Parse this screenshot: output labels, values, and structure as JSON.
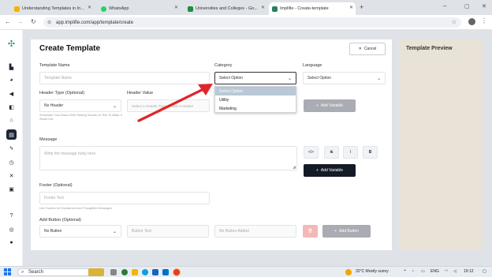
{
  "browser": {
    "tabs": [
      {
        "label": "Understanding Templates in In...",
        "favicon_color": "#f5b100"
      },
      {
        "label": "WhatsApp",
        "favicon_color": "#25d366"
      },
      {
        "label": "Universities and Colleges - Go...",
        "favicon_color": "#1e8e3e"
      },
      {
        "label": "Implifie - Create-template",
        "favicon_color": "#2a7f62"
      }
    ],
    "new_tab": "+",
    "url": "app.implifie.com/app/template/create",
    "window_controls": {
      "minimize": "–",
      "maximize": "▢",
      "close": "✕"
    }
  },
  "sidebar": {
    "icons": [
      "logo-icon",
      "chart-icon",
      "palette-icon",
      "campaign-icon",
      "broadcast-icon",
      "bank-icon",
      "template-icon",
      "flash-icon",
      "clock-icon",
      "tools-icon",
      "monitor-icon",
      "help-icon",
      "globe-icon",
      "user-icon"
    ]
  },
  "page": {
    "title": "Create Template",
    "cancel_label": "Cancel",
    "template_name": {
      "label": "Template Name",
      "placeholder": "Template Name"
    },
    "category": {
      "label": "Category",
      "value": "Select Option",
      "options": [
        "Select Option",
        "Utility",
        "Marketing"
      ]
    },
    "language": {
      "label": "Language",
      "value": "Select Option"
    },
    "header_type": {
      "label": "Header Type (Optional)",
      "value": "No Header",
      "hint": "Showcase Your Brand With Striking Visuals Or Text To Make It Stand Out."
    },
    "header_value": {
      "label": "Header Value",
      "placeholder": "Select a Header Type to add a Header"
    },
    "add_variable_label": "Add Variable",
    "message": {
      "label": "Message",
      "placeholder": "Write the message body here"
    },
    "format_buttons": [
      "</>",
      "S",
      "I",
      "B"
    ],
    "footer": {
      "label": "Footer (Optional)",
      "placeholder": "Footer Text",
      "hint": "Use Footers for Disclaimers And Thoughtful Messages"
    },
    "add_button": {
      "label": "Add Button (Optional)",
      "value": "No Button",
      "button_text_placeholder": "Button Text",
      "no_button_added": "No Button Added",
      "add_button_label": "Add Button"
    }
  },
  "preview": {
    "title": "Template Preview"
  },
  "taskbar": {
    "search_placeholder": "Search",
    "weather": "32°C  Mostly sunny",
    "lang": "ENG",
    "time": "19:12",
    "colors": {
      "accent": "#141a26",
      "preview_bg": "#e9e2d6",
      "arrow": "#e0262a"
    }
  }
}
